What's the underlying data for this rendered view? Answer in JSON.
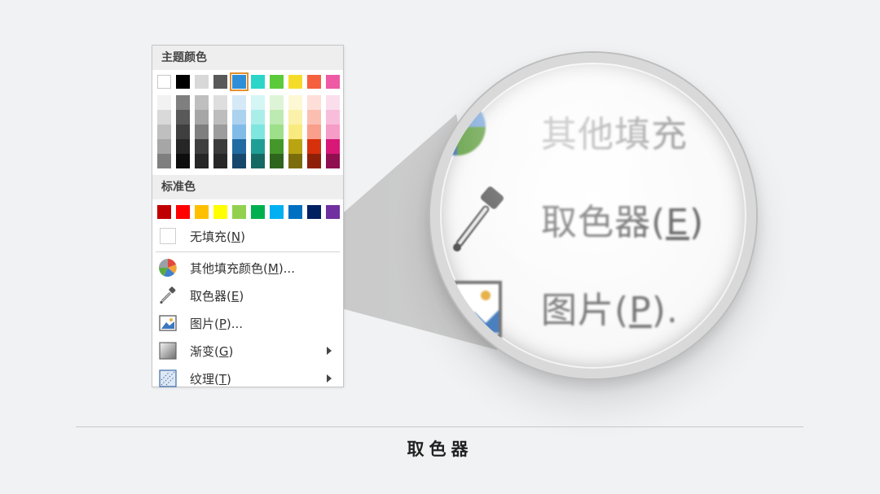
{
  "panel": {
    "theme_heading": "主题颜色",
    "standard_heading": "标准色",
    "theme_colors": [
      "#ffffff",
      "#000000",
      "#d8d8d8",
      "#595959",
      "#2e8fd8",
      "#2bd6c8",
      "#5ccb3b",
      "#f6dc2a",
      "#f5603e",
      "#ee5aa3"
    ],
    "selected_theme_index": 4,
    "theme_shades": [
      [
        "#f2f2f2",
        "#d9d9d9",
        "#bfbfbf",
        "#a6a6a6",
        "#7f7f7f"
      ],
      [
        "#7f7f7f",
        "#595959",
        "#3f3f3f",
        "#262626",
        "#0d0d0d"
      ],
      [
        "#bfbfbf",
        "#a6a6a6",
        "#7f7f7f",
        "#3f3f3f",
        "#262626"
      ],
      [
        "#dedede",
        "#bdbdbd",
        "#9c9c9c",
        "#3b3b3b",
        "#272727"
      ],
      [
        "#d5e9f7",
        "#abd2ef",
        "#81bce8",
        "#216ba2",
        "#16476c"
      ],
      [
        "#d4f6f4",
        "#aaeeea",
        "#7fe6df",
        "#1f9e95",
        "#156963"
      ],
      [
        "#def4d7",
        "#bdeab0",
        "#9de089",
        "#44982b",
        "#2d651d"
      ],
      [
        "#fdf7d4",
        "#fbf1aa",
        "#f9ea7f",
        "#bba412",
        "#7c6d0c"
      ],
      [
        "#fddfd8",
        "#fbbfb2",
        "#f99f8b",
        "#d6300c",
        "#8e2008"
      ],
      [
        "#fbdeec",
        "#f8bdda",
        "#f59cc7",
        "#d81776",
        "#900f4f"
      ]
    ],
    "standard_colors": [
      "#c00000",
      "#ff0000",
      "#ffc000",
      "#ffff00",
      "#92d050",
      "#00b050",
      "#00b0f0",
      "#0070c0",
      "#002060",
      "#7030a0"
    ],
    "menu": [
      {
        "key": "nofill",
        "label": "无填充(",
        "hotkey": "N",
        "tail": ")",
        "icon": "no-fill-icon",
        "submenu": false
      },
      {
        "key": "more",
        "label": "其他填充颜色(",
        "hotkey": "M",
        "tail": ")...",
        "icon": "color-wheel-icon",
        "submenu": false
      },
      {
        "key": "eyedropper",
        "label": "取色器(",
        "hotkey": "E",
        "tail": ")",
        "icon": "eyedropper-icon",
        "submenu": false
      },
      {
        "key": "picture",
        "label": "图片(",
        "hotkey": "P",
        "tail": ")...",
        "icon": "picture-icon",
        "submenu": false
      },
      {
        "key": "gradient",
        "label": "渐变(",
        "hotkey": "G",
        "tail": ")",
        "icon": "gradient-icon",
        "submenu": true
      },
      {
        "key": "texture",
        "label": "纹理(",
        "hotkey": "T",
        "tail": ")",
        "icon": "texture-icon",
        "submenu": true
      }
    ]
  },
  "magnifier": {
    "line1": "其他填充",
    "line2": "取色器(",
    "line2_hotkey": "E",
    "line2_tail": ")",
    "line3": "图片(",
    "line3_hotkey": "P",
    "line3_tail": ")."
  },
  "caption": "取色器"
}
